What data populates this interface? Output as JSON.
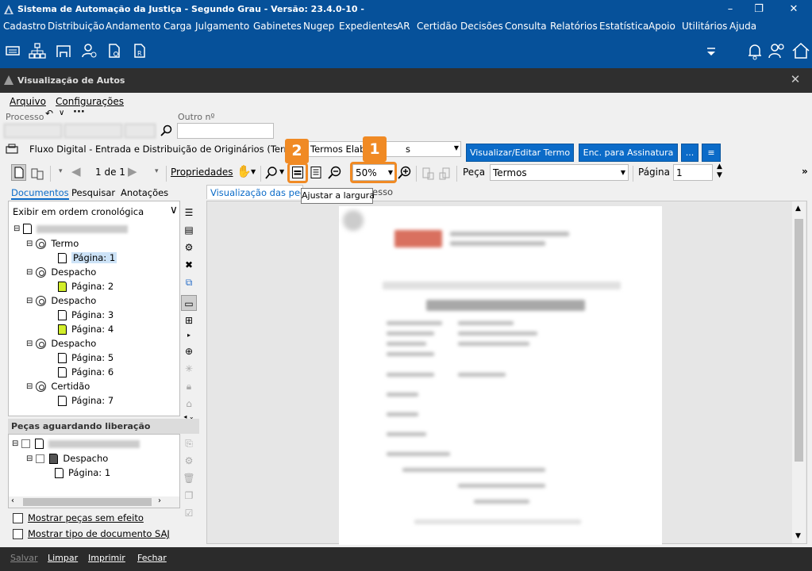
{
  "app_title": "Sistema de Automação da Justiça - Segundo Grau - Versão: 23.4.0-10 -",
  "menu": [
    "Cadastro",
    "Distribuição",
    "Andamento",
    "Carga",
    "Julgamento",
    "Gabinetes",
    "Nugep",
    "Expedientes",
    "AR",
    "Certidão",
    "Decisões",
    "Consulta",
    "Relatórios",
    "Estatística",
    "Apoio",
    "Utilitários",
    "Ajuda"
  ],
  "window_title": "Visualização de Autos",
  "menus2": {
    "arquivo": "Arquivo",
    "config": "Configurações"
  },
  "processo_label": "Processo",
  "outro_label": "Outro nº",
  "flow_text": "Fluxo Digital - Entrada e Distribuição de Originários (Termo) -",
  "flow_select": "Termos Elab",
  "flow_select_tail": "s",
  "btn_visualizar": "Visualizar/Editar Termo",
  "btn_enc": "Enc. para Assinatura",
  "btn_more": "...",
  "page_counter": "1 de 1",
  "propriedades": "Propriedades",
  "zoom": "50%",
  "peca_label": "Peça",
  "peca_value": "Termos",
  "pagina_label": "Página",
  "pagina_value": "1",
  "tabs": {
    "documentos": "Documentos",
    "pesquisar": "Pesquisar",
    "anotacoes": "Anotações"
  },
  "order_select": "Exibir em ordem cronológica",
  "tree": [
    {
      "type": "Termo",
      "pages": [
        {
          "label": "Página: 1",
          "yellow": false,
          "selected": true
        }
      ]
    },
    {
      "type": "Despacho",
      "pages": [
        {
          "label": "Página: 2",
          "yellow": true
        }
      ]
    },
    {
      "type": "Despacho",
      "pages": [
        {
          "label": "Página: 3",
          "yellow": false
        },
        {
          "label": "Página: 4",
          "yellow": true
        }
      ]
    },
    {
      "type": "Despacho",
      "pages": [
        {
          "label": "Página: 5",
          "yellow": false
        },
        {
          "label": "Página: 6",
          "yellow": false
        }
      ]
    },
    {
      "type": "Certidão",
      "pages": [
        {
          "label": "Página: 7",
          "yellow": false
        }
      ]
    }
  ],
  "pending_header": "Peças aguardando liberação",
  "pending": {
    "type": "Despacho",
    "page": "Página: 1"
  },
  "check1": "Mostrar peças sem efeito",
  "check2": "Mostrar tipo de documento SAJ",
  "view_tab": "Visualização das peças",
  "view_tab2": "esso",
  "tooltip": "Ajustar a largura",
  "badges": {
    "one": "1",
    "two": "2"
  },
  "bottom": {
    "salvar": "Salvar",
    "limpar": "Limpar",
    "imprimir": "Imprimir",
    "fechar": "Fechar"
  },
  "colors": {
    "brand": "#06519a",
    "accent_button": "#0b6bc8",
    "highlight": "#f08a24",
    "dark_bar": "#2f2f2f"
  }
}
